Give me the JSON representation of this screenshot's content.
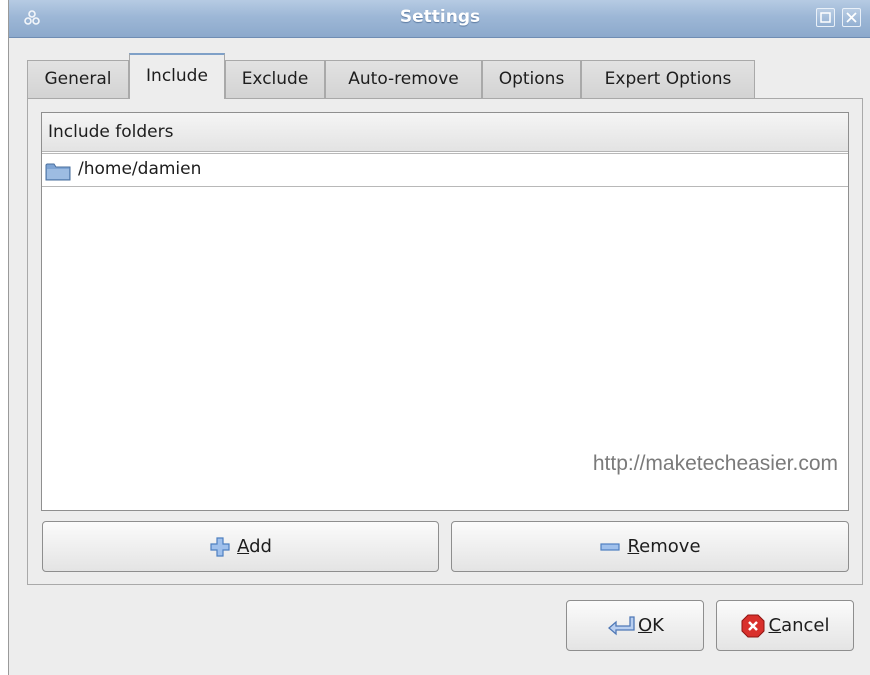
{
  "window": {
    "title": "Settings"
  },
  "tabs": [
    {
      "label": "General",
      "active": false
    },
    {
      "label": "Include",
      "active": true
    },
    {
      "label": "Exclude",
      "active": false
    },
    {
      "label": "Auto-remove",
      "active": false
    },
    {
      "label": "Options",
      "active": false
    },
    {
      "label": "Expert Options",
      "active": false
    }
  ],
  "include_list": {
    "column_header": "Include folders",
    "items": [
      {
        "path": "/home/damien",
        "icon": "folder-icon"
      }
    ]
  },
  "watermark": "http://maketecheasier.com",
  "buttons": {
    "add_mnemonic": "A",
    "add_rest": "dd",
    "remove_mnemonic": "R",
    "remove_rest": "emove",
    "ok_mnemonic": "O",
    "ok_rest": "K",
    "cancel_mnemonic": "C",
    "cancel_rest": "ancel"
  },
  "colors": {
    "titlebar": "#9db7d6",
    "cancel_icon": "#d9302c",
    "add_icon": "#5a8bd0"
  }
}
